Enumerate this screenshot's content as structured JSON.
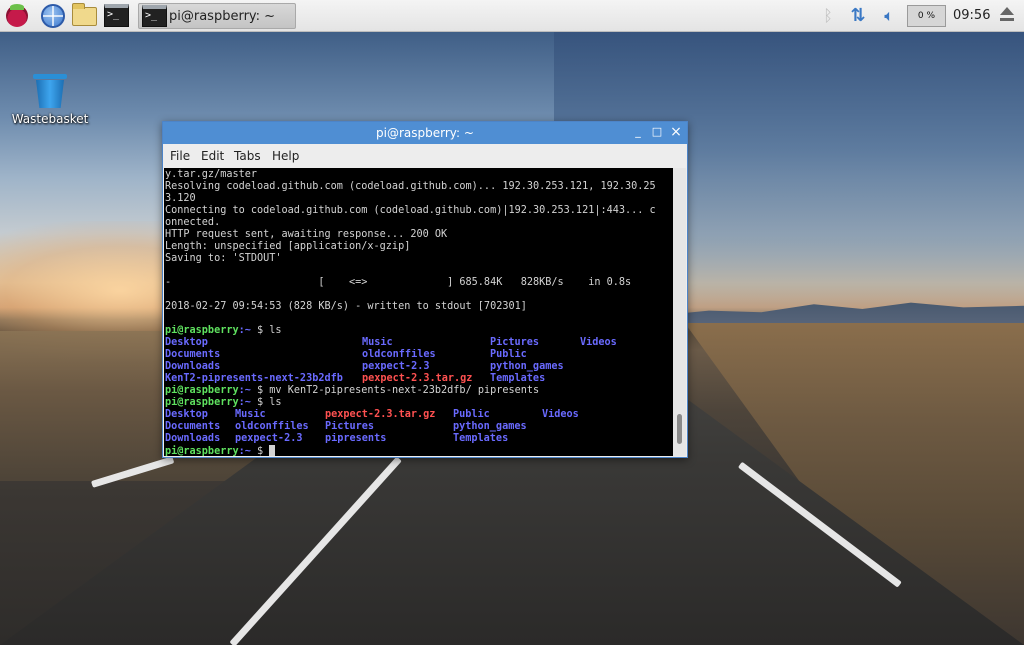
{
  "taskbar": {
    "task_label": "pi@raspberry: ~",
    "cpu_label": "0 %",
    "clock": "09:56",
    "icons": [
      "raspberry-menu-icon",
      "web-browser-icon",
      "file-manager-icon",
      "terminal-icon",
      "bluetooth-icon",
      "network-icon",
      "volume-icon",
      "eject-icon"
    ]
  },
  "desktop": {
    "wastebasket_label": "Wastebasket"
  },
  "terminal": {
    "title": "pi@raspberry: ~",
    "controls": [
      "_",
      "□",
      "×"
    ],
    "menu": [
      "File",
      "Edit",
      "Tabs",
      "Help"
    ],
    "prompt": "pi@raspberry",
    "lines": {
      "l1": "y.tar.gz/master",
      "l2": "Resolving codeload.github.com (codeload.github.com)... 192.30.253.121, 192.30.25",
      "l3": "3.120",
      "l4": "Connecting to codeload.github.com (codeload.github.com)|192.30.253.121|:443... c",
      "l5": "onnected.",
      "l6": "HTTP request sent, awaiting response... 200 OK",
      "l7": "Length: unspecified [application/x-gzip]",
      "l8": "Saving to: 'STDOUT'",
      "l9": "-                        [    <=>             ] 685.84K   828KB/s    in 0.8s",
      "l10": "2018-02-27 09:54:53 (828 KB/s) - written to stdout [702301]"
    },
    "cmd1": "$ ls",
    "ls1": {
      "c1": [
        "Desktop",
        "Documents",
        "Downloads",
        "KenT2-pipresents-next-23b2dfb"
      ],
      "c2": [
        "Music",
        "oldconffiles",
        "pexpect-2.3",
        "pexpect-2.3.tar.gz"
      ],
      "c3": [
        "Pictures",
        "Public",
        "python_games",
        "Templates"
      ],
      "c4": [
        "Videos"
      ]
    },
    "cmd2": "$ mv KenT2-pipresents-next-23b2dfb/ pipresents",
    "cmd3": "$ ls",
    "ls2": {
      "c1": [
        "Desktop",
        "Documents",
        "Downloads"
      ],
      "c2": [
        "Music",
        "oldconffiles",
        "pexpect-2.3"
      ],
      "c3": [
        "pexpect-2.3.tar.gz",
        "Pictures",
        "pipresents"
      ],
      "c4": [
        "Public",
        "python_games",
        "Templates"
      ],
      "c5": [
        "Videos"
      ]
    },
    "cmd4": "$ "
  }
}
